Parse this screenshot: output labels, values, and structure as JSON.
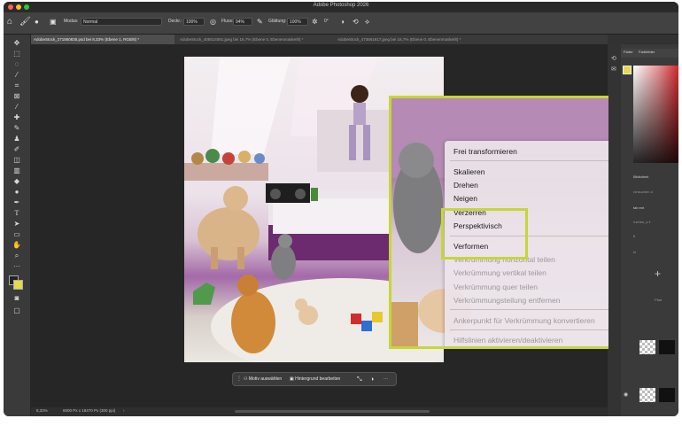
{
  "window": {
    "title": "Adobe Photoshop 2026"
  },
  "options_bar": {
    "mode_label": "Modus:",
    "mode_value": "Normal",
    "opacity_label": "Deckr.:",
    "opacity_value": "100%",
    "flow_label": "Fluss:",
    "flow_value": "94%",
    "smoothing_label": "Glättung:",
    "smoothing_value": "100%",
    "angle_value": "0°"
  },
  "tabs": [
    {
      "label": "AdobeStock_271860835.psd bei 8,33% (Ebene 1, RGB/8) *"
    },
    {
      "label": "AdobeStock_405514091.jpeg bei 16,7% (Ebene 0, Ebenenmaske/8) *"
    },
    {
      "label": "AdobeStock_473661917.jpeg bei 16,7% (Ebene 0, Ebenenmaske/8) *"
    }
  ],
  "context_menu": {
    "items": [
      {
        "label": "Frei transformieren",
        "enabled": true
      },
      {
        "label": "Skalieren",
        "enabled": true
      },
      {
        "label": "Drehen",
        "enabled": true
      },
      {
        "label": "Neigen",
        "enabled": true
      },
      {
        "label": "Verzerren",
        "enabled": true
      },
      {
        "label": "Perspektivisch",
        "enabled": true
      },
      {
        "label": "Verformen",
        "enabled": true
      },
      {
        "label": "Verkrümmung horizontal teilen",
        "enabled": false
      },
      {
        "label": "Verkrümmung vertikal teilen",
        "enabled": false
      },
      {
        "label": "Verkrümmung quer teilen",
        "enabled": false
      },
      {
        "label": "Verkrümmungsteilung entfernen",
        "enabled": false
      },
      {
        "label": "Ankerpunkt für Verkrümmung konvertieren",
        "enabled": false
      },
      {
        "label": "Hilfslinien aktivieren/deaktivieren",
        "enabled": false
      }
    ]
  },
  "contextual_taskbar": {
    "select_subject": "Motiv auswählen",
    "edit_background": "Hintergrund bearbeiten",
    "more": "···"
  },
  "status_bar": {
    "zoom": "8,33%",
    "doc_info": "6000 Px x 18470 Px (300 ppi)",
    "arrow": "›"
  },
  "right_panel": {
    "tabs": [
      "Farbe",
      "Farbfelder"
    ],
    "library_label": "Bibliothek",
    "search_hint": "rchsuchen d",
    "tab_label": "tab ent",
    "file_hint": "ruchen_s.1",
    "t_hint": "tt",
    "ki_hint": "ki",
    "p_hint": "Pfad"
  },
  "colors": {
    "accent_highlight": "#c6d637",
    "app_background": "#323232",
    "color_spectrum_red": "#d2282b"
  }
}
